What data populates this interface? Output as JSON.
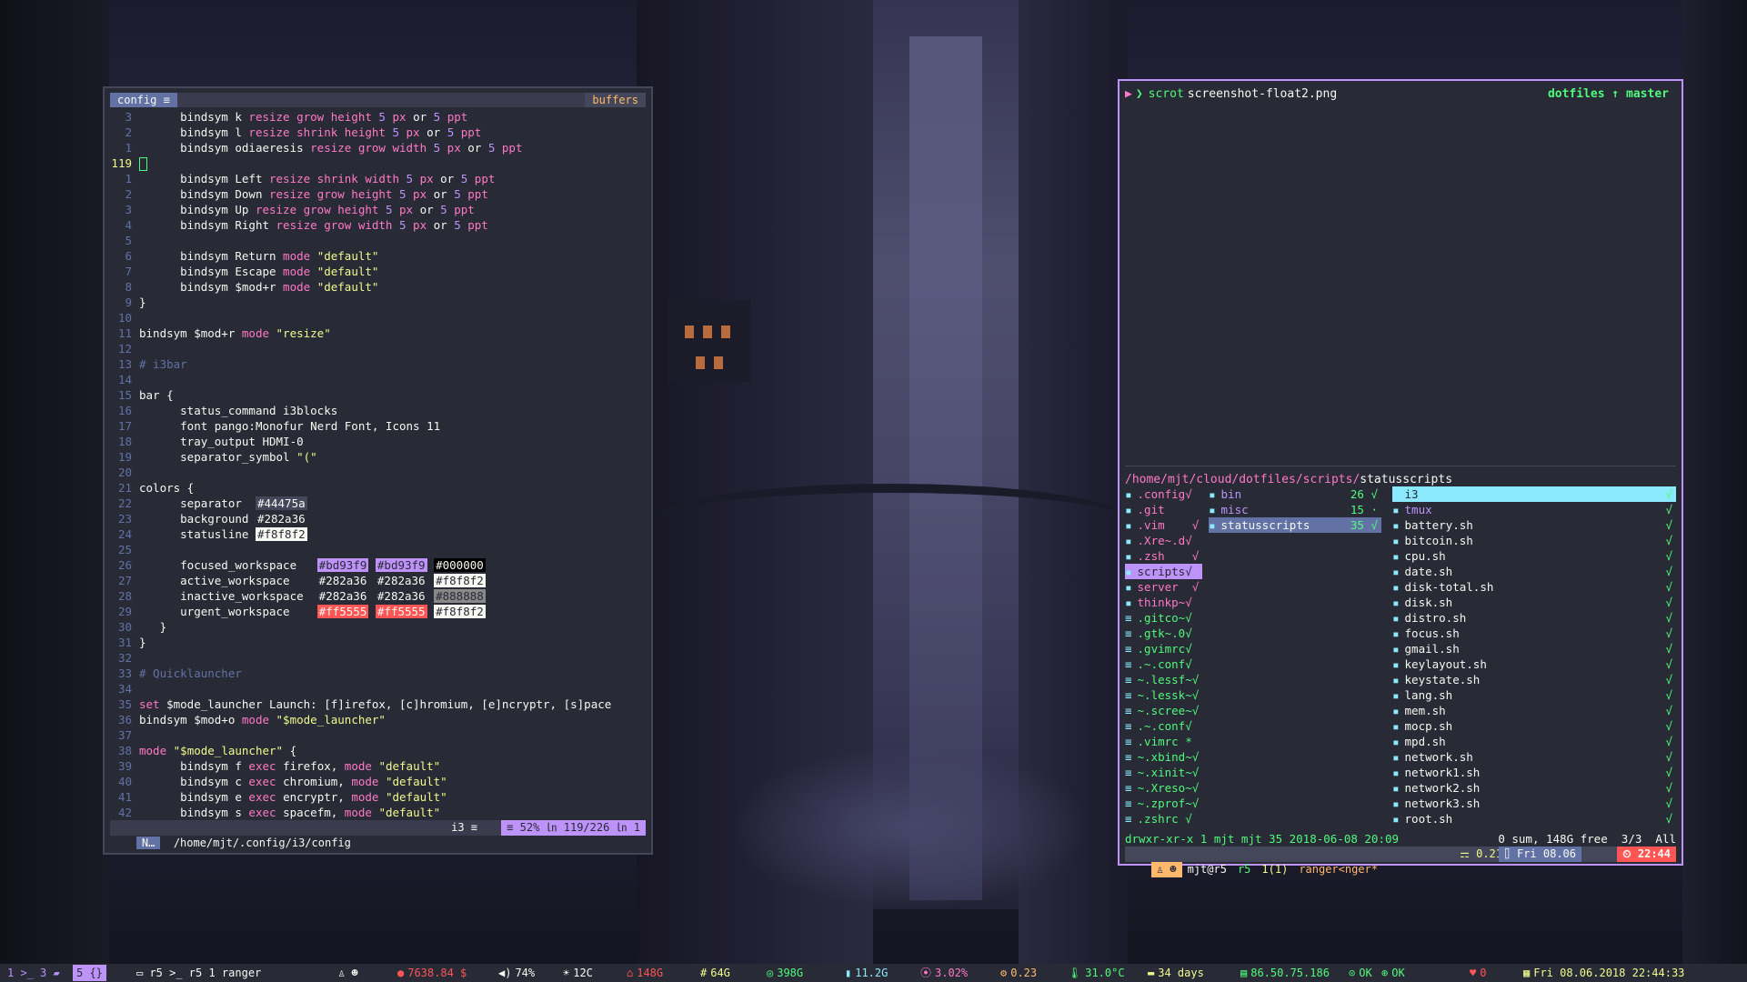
{
  "editor": {
    "tab_label": "config ≡",
    "buffers_label": "buffers",
    "lines": [
      {
        "num": "3",
        "indent": "      ",
        "parts": [
          [
            "bindsym k ",
            ""
          ],
          [
            "resize grow height ",
            "kw"
          ],
          [
            "5",
            "nb"
          ],
          [
            " px ",
            "kw"
          ],
          [
            "or ",
            ""
          ],
          [
            "5",
            "nb"
          ],
          [
            " ppt",
            "kw"
          ]
        ]
      },
      {
        "num": "2",
        "indent": "      ",
        "parts": [
          [
            "bindsym l ",
            ""
          ],
          [
            "resize shrink height ",
            "kw"
          ],
          [
            "5",
            "nb"
          ],
          [
            " px ",
            "kw"
          ],
          [
            "or ",
            ""
          ],
          [
            "5",
            "nb"
          ],
          [
            " ppt",
            "kw"
          ]
        ]
      },
      {
        "num": "1",
        "indent": "      ",
        "parts": [
          [
            "bindsym odiaeresis ",
            ""
          ],
          [
            "resize grow width ",
            "kw"
          ],
          [
            "5",
            "nb"
          ],
          [
            " px ",
            "kw"
          ],
          [
            "or ",
            ""
          ],
          [
            "5",
            "nb"
          ],
          [
            " ppt",
            "kw"
          ]
        ]
      },
      {
        "num": "119",
        "indent": "",
        "parts": [],
        "current": true
      },
      {
        "num": "1",
        "indent": "      ",
        "parts": [
          [
            "bindsym Left ",
            ""
          ],
          [
            "resize shrink width ",
            "kw"
          ],
          [
            "5",
            "nb"
          ],
          [
            " px ",
            "kw"
          ],
          [
            "or ",
            ""
          ],
          [
            "5",
            "nb"
          ],
          [
            " ppt",
            "kw"
          ]
        ]
      },
      {
        "num": "2",
        "indent": "      ",
        "parts": [
          [
            "bindsym Down ",
            ""
          ],
          [
            "resize grow height ",
            "kw"
          ],
          [
            "5",
            "nb"
          ],
          [
            " px ",
            "kw"
          ],
          [
            "or ",
            ""
          ],
          [
            "5",
            "nb"
          ],
          [
            " ppt",
            "kw"
          ]
        ]
      },
      {
        "num": "3",
        "indent": "      ",
        "parts": [
          [
            "bindsym Up ",
            ""
          ],
          [
            "resize grow height ",
            "kw"
          ],
          [
            "5",
            "nb"
          ],
          [
            " px ",
            "kw"
          ],
          [
            "or ",
            ""
          ],
          [
            "5",
            "nb"
          ],
          [
            " ppt",
            "kw"
          ]
        ]
      },
      {
        "num": "4",
        "indent": "      ",
        "parts": [
          [
            "bindsym Right ",
            ""
          ],
          [
            "resize grow width ",
            "kw"
          ],
          [
            "5",
            "nb"
          ],
          [
            " px ",
            "kw"
          ],
          [
            "or ",
            ""
          ],
          [
            "5",
            "nb"
          ],
          [
            " ppt",
            "kw"
          ]
        ]
      },
      {
        "num": "5",
        "indent": "",
        "parts": []
      },
      {
        "num": "6",
        "indent": "      ",
        "parts": [
          [
            "bindsym Return ",
            ""
          ],
          [
            "mode ",
            "kw"
          ],
          [
            "\"default\"",
            "str"
          ]
        ]
      },
      {
        "num": "7",
        "indent": "      ",
        "parts": [
          [
            "bindsym Escape ",
            ""
          ],
          [
            "mode ",
            "kw"
          ],
          [
            "\"default\"",
            "str"
          ]
        ]
      },
      {
        "num": "8",
        "indent": "      ",
        "parts": [
          [
            "bindsym $mod+r ",
            ""
          ],
          [
            "mode ",
            "kw"
          ],
          [
            "\"default\"",
            "str"
          ]
        ]
      },
      {
        "num": "9",
        "indent": "",
        "parts": [
          [
            "}",
            ""
          ]
        ]
      },
      {
        "num": "10",
        "indent": "",
        "parts": []
      },
      {
        "num": "11",
        "indent": "",
        "parts": [
          [
            "bindsym $mod+r ",
            ""
          ],
          [
            "mode ",
            "kw"
          ],
          [
            "\"resize\"",
            "str"
          ]
        ]
      },
      {
        "num": "12",
        "indent": "",
        "parts": []
      },
      {
        "num": "13",
        "indent": "",
        "parts": [
          [
            "# i3bar",
            "cm"
          ]
        ]
      },
      {
        "num": "14",
        "indent": "",
        "parts": []
      },
      {
        "num": "15",
        "indent": "",
        "parts": [
          [
            "bar {",
            ""
          ]
        ]
      },
      {
        "num": "16",
        "indent": "      ",
        "parts": [
          [
            "status_command i3blocks",
            ""
          ]
        ]
      },
      {
        "num": "17",
        "indent": "      ",
        "parts": [
          [
            "font pango:Monofur Nerd Font, Icons 11",
            ""
          ]
        ]
      },
      {
        "num": "18",
        "indent": "      ",
        "parts": [
          [
            "tray_output HDMI-0",
            ""
          ]
        ]
      },
      {
        "num": "19",
        "indent": "      ",
        "parts": [
          [
            "separator_symbol ",
            ""
          ],
          [
            "\"(\"",
            "str"
          ]
        ]
      },
      {
        "num": "20",
        "indent": "",
        "parts": []
      },
      {
        "num": "21",
        "indent": "",
        "parts": [
          [
            "colors {",
            ""
          ]
        ]
      },
      {
        "num": "22",
        "indent": "      ",
        "parts": [
          [
            "separator  ",
            ""
          ],
          [
            "#44475a",
            "sw1"
          ]
        ]
      },
      {
        "num": "23",
        "indent": "      ",
        "parts": [
          [
            "background ",
            ""
          ],
          [
            "#282a36",
            "sw2"
          ]
        ]
      },
      {
        "num": "24",
        "indent": "      ",
        "parts": [
          [
            "statusline ",
            ""
          ],
          [
            "#f8f8f2",
            "sw3"
          ]
        ]
      },
      {
        "num": "25",
        "indent": "",
        "parts": []
      },
      {
        "num": "26",
        "indent": "      ",
        "parts": [
          [
            "focused_workspace   ",
            ""
          ],
          [
            "#bd93f9",
            "sw4"
          ],
          [
            " ",
            ""
          ],
          [
            "#bd93f9",
            "sw4"
          ],
          [
            " ",
            ""
          ],
          [
            "#000000",
            "sw5"
          ]
        ]
      },
      {
        "num": "27",
        "indent": "      ",
        "parts": [
          [
            "active_workspace    ",
            ""
          ],
          [
            "#282a36",
            "sw2"
          ],
          [
            " ",
            ""
          ],
          [
            "#282a36",
            "sw2"
          ],
          [
            " ",
            ""
          ],
          [
            "#f8f8f2",
            "sw3"
          ]
        ]
      },
      {
        "num": "28",
        "indent": "      ",
        "parts": [
          [
            "inactive_workspace  ",
            ""
          ],
          [
            "#282a36",
            "sw2"
          ],
          [
            " ",
            ""
          ],
          [
            "#282a36",
            "sw2"
          ],
          [
            " ",
            ""
          ],
          [
            "#888888",
            "sw6"
          ]
        ]
      },
      {
        "num": "29",
        "indent": "      ",
        "parts": [
          [
            "urgent_workspace    ",
            ""
          ],
          [
            "#ff5555",
            "sw7"
          ],
          [
            " ",
            ""
          ],
          [
            "#ff5555",
            "sw7"
          ],
          [
            " ",
            ""
          ],
          [
            "#f8f8f2",
            "sw3"
          ]
        ]
      },
      {
        "num": "30",
        "indent": "   ",
        "parts": [
          [
            "}",
            ""
          ]
        ]
      },
      {
        "num": "31",
        "indent": "",
        "parts": [
          [
            "}",
            ""
          ]
        ]
      },
      {
        "num": "32",
        "indent": "",
        "parts": []
      },
      {
        "num": "33",
        "indent": "",
        "parts": [
          [
            "# Quicklauncher",
            "cm"
          ]
        ]
      },
      {
        "num": "34",
        "indent": "",
        "parts": []
      },
      {
        "num": "35",
        "indent": "",
        "parts": [
          [
            "set ",
            "kw"
          ],
          [
            "$mode_launcher Launch: [f]irefox, [c]hromium, [e]ncryptr, [s]pace",
            ""
          ]
        ]
      },
      {
        "num": "36",
        "indent": "",
        "parts": [
          [
            "bindsym $mod+o ",
            ""
          ],
          [
            "mode ",
            "kw"
          ],
          [
            "\"$mode_launcher\"",
            "str"
          ]
        ]
      },
      {
        "num": "37",
        "indent": "",
        "parts": []
      },
      {
        "num": "38",
        "indent": "",
        "parts": [
          [
            "mode ",
            "kw"
          ],
          [
            "\"$mode_launcher\"",
            "str"
          ],
          [
            " {",
            ""
          ]
        ]
      },
      {
        "num": "39",
        "indent": "      ",
        "parts": [
          [
            "bindsym f ",
            ""
          ],
          [
            "exec ",
            "kw"
          ],
          [
            "firefox, ",
            ""
          ],
          [
            "mode ",
            "kw"
          ],
          [
            "\"default\"",
            "str"
          ]
        ]
      },
      {
        "num": "40",
        "indent": "      ",
        "parts": [
          [
            "bindsym c ",
            ""
          ],
          [
            "exec ",
            "kw"
          ],
          [
            "chromium, ",
            ""
          ],
          [
            "mode ",
            "kw"
          ],
          [
            "\"default\"",
            "str"
          ]
        ]
      },
      {
        "num": "41",
        "indent": "      ",
        "parts": [
          [
            "bindsym e ",
            ""
          ],
          [
            "exec ",
            "kw"
          ],
          [
            "encryptr, ",
            ""
          ],
          [
            "mode ",
            "kw"
          ],
          [
            "\"default\"",
            "str"
          ]
        ]
      },
      {
        "num": "42",
        "indent": "      ",
        "parts": [
          [
            "bindsym s ",
            ""
          ],
          [
            "exec ",
            "kw"
          ],
          [
            "spacefm, ",
            ""
          ],
          [
            "mode ",
            "kw"
          ],
          [
            "\"default\"",
            "str"
          ]
        ]
      }
    ],
    "status": {
      "mode": "N…",
      "path": "/home/mjt/.config/i3/config",
      "filetype": "i3 ≡",
      "position": "≡ 52% ㏑ 119/226 ㏑ 1"
    }
  },
  "terminal": {
    "prompt_cmd": "scrot",
    "prompt_arg": "screenshot-float2.png",
    "git_status": "dotfiles ↑ master",
    "ranger": {
      "path_prefix": "/home/mjt/cloud/dotfiles/scripts/",
      "path_current": "statusscripts",
      "col1": [
        {
          "name": ".config√",
          "type": "dir"
        },
        {
          "name": ".git",
          "type": "dir"
        },
        {
          "name": ".vim    √",
          "type": "dir"
        },
        {
          "name": ".Xre~.d√",
          "type": "dir"
        },
        {
          "name": ".zsh    √",
          "type": "dir"
        },
        {
          "name": "scripts√",
          "type": "dir",
          "hl": "hl1"
        },
        {
          "name": "server  √",
          "type": "dir"
        },
        {
          "name": "thinkp~√",
          "type": "dir"
        },
        {
          "name": ".gitco~√",
          "type": "file"
        },
        {
          "name": ".gtk~.0√",
          "type": "file"
        },
        {
          "name": ".gvimrc√",
          "type": "file"
        },
        {
          "name": ".~.conf√",
          "type": "file"
        },
        {
          "name": "~.lessf~√",
          "type": "file"
        },
        {
          "name": "~.lessk~√",
          "type": "file"
        },
        {
          "name": "~.scree~√",
          "type": "file"
        },
        {
          "name": ".~.conf√",
          "type": "file"
        },
        {
          "name": ".vimrc *",
          "type": "file"
        },
        {
          "name": "~.xbind~√",
          "type": "file"
        },
        {
          "name": "~.xinit~√",
          "type": "file"
        },
        {
          "name": "~.Xreso~√",
          "type": "file"
        },
        {
          "name": "~.zprof~√",
          "type": "file"
        },
        {
          "name": ".zshrc √",
          "type": "file"
        }
      ],
      "col2": [
        {
          "name": "bin",
          "count": "26 √"
        },
        {
          "name": "misc",
          "count": "15 ·"
        },
        {
          "name": "statusscripts",
          "count": "35 √",
          "hl": "hl3"
        }
      ],
      "col3": [
        {
          "name": "i3",
          "type": "dir",
          "hl": "hl2"
        },
        {
          "name": "tmux",
          "type": "dir"
        },
        {
          "name": "battery.sh"
        },
        {
          "name": "bitcoin.sh"
        },
        {
          "name": "cpu.sh"
        },
        {
          "name": "date.sh"
        },
        {
          "name": "disk-total.sh"
        },
        {
          "name": "disk.sh"
        },
        {
          "name": "distro.sh"
        },
        {
          "name": "focus.sh"
        },
        {
          "name": "gmail.sh"
        },
        {
          "name": "keylayout.sh"
        },
        {
          "name": "keystate.sh"
        },
        {
          "name": "lang.sh"
        },
        {
          "name": "mem.sh"
        },
        {
          "name": "mocp.sh"
        },
        {
          "name": "mpd.sh"
        },
        {
          "name": "network.sh"
        },
        {
          "name": "network1.sh"
        },
        {
          "name": "network2.sh"
        },
        {
          "name": "network3.sh"
        },
        {
          "name": "root.sh"
        }
      ],
      "check_mark": "√",
      "info_left": "drwxr-xr-x 1 mjt mjt 35 2018-06-08 20:09",
      "info_right": "0 sum, 148G free  3/3  All"
    },
    "tmux": {
      "left_icons": "♙ ☻",
      "host": "mjt@r5",
      "session": "r5",
      "window": "1(1)",
      "pane": "ranger<nger*",
      "load": "⚎ 0.21",
      "date": "⌷ Fri 08.06",
      "time": "⏲ 22:44"
    }
  },
  "bar": {
    "workspaces": [
      {
        "label": "1 >_",
        "focused": false
      },
      {
        "label": "3 ▰",
        "focused": false
      },
      {
        "label": "5 {}",
        "focused": true
      }
    ],
    "title": "▭ r5 >_ r5   1 ranger",
    "blocks": [
      {
        "icon": "♙ ☻",
        "text": "",
        "color": "#f8f8f2"
      },
      {
        "icon": "●",
        "text": "7638.84 $",
        "color": "#ff5555"
      },
      {
        "icon": "◀)",
        "text": "74%",
        "color": "#f8f8f2"
      },
      {
        "icon": "☀",
        "text": "12C",
        "color": "#f8f8f2"
      },
      {
        "icon": "⌂",
        "text": "148G",
        "color": "#ff5555"
      },
      {
        "icon": "#",
        "text": "64G",
        "color": "#f1fa8c"
      },
      {
        "icon": "◎",
        "text": "398G",
        "color": "#50fa7b"
      },
      {
        "icon": "▮",
        "text": "11.2G",
        "color": "#8be9fd"
      },
      {
        "icon": "⦿",
        "text": "3.02%",
        "color": "#ff79c6"
      },
      {
        "icon": "⚙",
        "text": "0.23",
        "color": "#ffb86c"
      },
      {
        "icon": "🌡",
        "text": "31.0°C",
        "color": "#50fa7b"
      },
      {
        "icon": "▬",
        "text": "34 days",
        "color": "#f1fa8c"
      },
      {
        "icon": "▤",
        "text": "86.50.75.186",
        "color": "#50fa7b"
      },
      {
        "icon": "⊙",
        "text": "OK",
        "color": "#50fa7b"
      },
      {
        "icon": "⊕",
        "text": "OK",
        "color": "#50fa7b"
      },
      {
        "icon": "♥",
        "text": "0",
        "color": "#ff5555"
      },
      {
        "icon": "▦",
        "text": "Fri 08.06.2018 22:44:33",
        "color": "#f1fa8c"
      }
    ]
  },
  "colors": {
    "background": "#282a36",
    "purple": "#bd93f9",
    "pink": "#ff79c6",
    "green": "#50fa7b",
    "red": "#ff5555",
    "yellow": "#f1fa8c"
  }
}
